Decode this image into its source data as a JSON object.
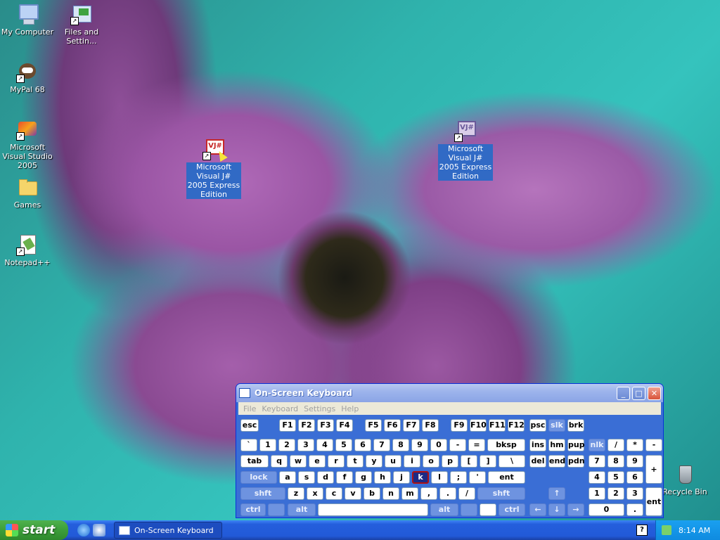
{
  "desktop_icons": [
    {
      "label": "My Computer",
      "icon": "computer-icon"
    },
    {
      "label": "Files and Settin...",
      "icon": "files-transfer-icon"
    },
    {
      "label": "MyPal 68",
      "icon": "raccoon-icon"
    },
    {
      "label": "Microsoft Visual Studio 2005",
      "icon": "visual-studio-icon"
    },
    {
      "label": "Games",
      "icon": "folder-icon"
    },
    {
      "label": "Notepad++",
      "icon": "notepad-icon"
    },
    {
      "label": "Microsoft Visual J# 2005 Express Edition",
      "icon": "vjsharp-icon"
    },
    {
      "label": "Microsoft Visual J# 2005 Express Edition",
      "icon": "vjsharp-icon"
    },
    {
      "label": "Recycle Bin",
      "icon": "recycle-bin-icon"
    }
  ],
  "osk": {
    "title": "On-Screen Keyboard",
    "menu": [
      "File",
      "Keyboard",
      "Settings",
      "Help"
    ],
    "row_fn": [
      "esc",
      "F1",
      "F2",
      "F3",
      "F4",
      "F5",
      "F6",
      "F7",
      "F8",
      "F9",
      "F10",
      "F11",
      "F12",
      "psc",
      "slk",
      "brk"
    ],
    "row_num": [
      "`",
      "1",
      "2",
      "3",
      "4",
      "5",
      "6",
      "7",
      "8",
      "9",
      "0",
      "-",
      "=",
      "bksp"
    ],
    "row_q": [
      "tab",
      "q",
      "w",
      "e",
      "r",
      "t",
      "y",
      "u",
      "i",
      "o",
      "p",
      "[",
      "]",
      "\\"
    ],
    "row_a": [
      "lock",
      "a",
      "s",
      "d",
      "f",
      "g",
      "h",
      "j",
      "k",
      "l",
      ";",
      "'",
      "ent"
    ],
    "row_z": [
      "shft",
      "z",
      "x",
      "c",
      "v",
      "b",
      "n",
      "m",
      ",",
      ".",
      "/",
      "shft"
    ],
    "row_ctrl": [
      "ctrl",
      "alt",
      "alt",
      "ctrl"
    ],
    "nav": [
      "ins",
      "hm",
      "pup",
      "del",
      "end",
      "pdn"
    ],
    "numpad": [
      "nlk",
      "/",
      "*",
      "-",
      "7",
      "8",
      "9",
      "+",
      "4",
      "5",
      "6",
      "1",
      "2",
      "3",
      "ent",
      "0",
      "."
    ],
    "arrows": [
      "↑",
      "←",
      "↓",
      "→"
    ],
    "pressed_key": "k"
  },
  "taskbar": {
    "start_label": "start",
    "task_label": "On-Screen Keyboard",
    "time": "8:14 AM",
    "help": "?"
  }
}
